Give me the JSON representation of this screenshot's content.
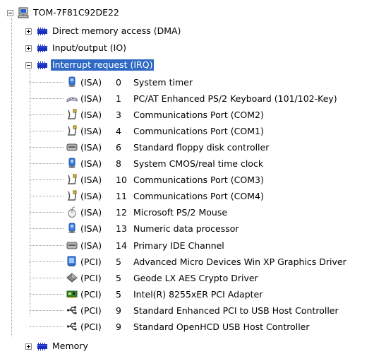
{
  "computer": {
    "name": "TOM-7F81C92DE22",
    "icon": "computer-icon"
  },
  "categories": [
    {
      "label": "Direct memory access (DMA)",
      "icon": "device-category-icon",
      "expanded": false
    },
    {
      "label": "Input/output (IO)",
      "icon": "device-category-icon",
      "expanded": false
    },
    {
      "label": "Interrupt request (IRQ)",
      "icon": "device-category-icon",
      "expanded": true,
      "selected": true
    },
    {
      "label": "Memory",
      "icon": "device-category-icon",
      "expanded": false
    }
  ],
  "irq_items": [
    {
      "bus": "(ISA)",
      "num": "0",
      "name": "System timer",
      "icon": "system-device-icon"
    },
    {
      "bus": "(ISA)",
      "num": "1",
      "name": "PC/AT Enhanced PS/2 Keyboard (101/102-Key)",
      "icon": "keyboard-icon"
    },
    {
      "bus": "(ISA)",
      "num": "3",
      "name": "Communications Port (COM2)",
      "icon": "port-icon"
    },
    {
      "bus": "(ISA)",
      "num": "4",
      "name": "Communications Port (COM1)",
      "icon": "port-icon"
    },
    {
      "bus": "(ISA)",
      "num": "6",
      "name": "Standard floppy disk controller",
      "icon": "disk-controller-icon"
    },
    {
      "bus": "(ISA)",
      "num": "8",
      "name": "System CMOS/real time clock",
      "icon": "system-device-icon"
    },
    {
      "bus": "(ISA)",
      "num": "10",
      "name": "Communications Port (COM3)",
      "icon": "port-icon"
    },
    {
      "bus": "(ISA)",
      "num": "11",
      "name": "Communications Port (COM4)",
      "icon": "port-icon"
    },
    {
      "bus": "(ISA)",
      "num": "12",
      "name": "Microsoft PS/2 Mouse",
      "icon": "mouse-icon"
    },
    {
      "bus": "(ISA)",
      "num": "13",
      "name": "Numeric data processor",
      "icon": "system-device-icon"
    },
    {
      "bus": "(ISA)",
      "num": "14",
      "name": "Primary IDE Channel",
      "icon": "disk-controller-icon"
    },
    {
      "bus": "(PCI)",
      "num": "5",
      "name": "Advanced Micro Devices Win XP Graphics Driver",
      "icon": "display-adapter-icon"
    },
    {
      "bus": "(PCI)",
      "num": "5",
      "name": "Geode LX AES Crypto Driver",
      "icon": "crypto-device-icon"
    },
    {
      "bus": "(PCI)",
      "num": "5",
      "name": "Intel(R) 8255xER PCI Adapter",
      "icon": "network-adapter-icon"
    },
    {
      "bus": "(PCI)",
      "num": "9",
      "name": "Standard Enhanced PCI to USB Host Controller",
      "icon": "usb-icon"
    },
    {
      "bus": "(PCI)",
      "num": "9",
      "name": "Standard OpenHCD USB Host Controller",
      "icon": "usb-icon"
    }
  ],
  "colors": {
    "selection": "#316ac5",
    "category_icon": "#1a2fc0"
  }
}
